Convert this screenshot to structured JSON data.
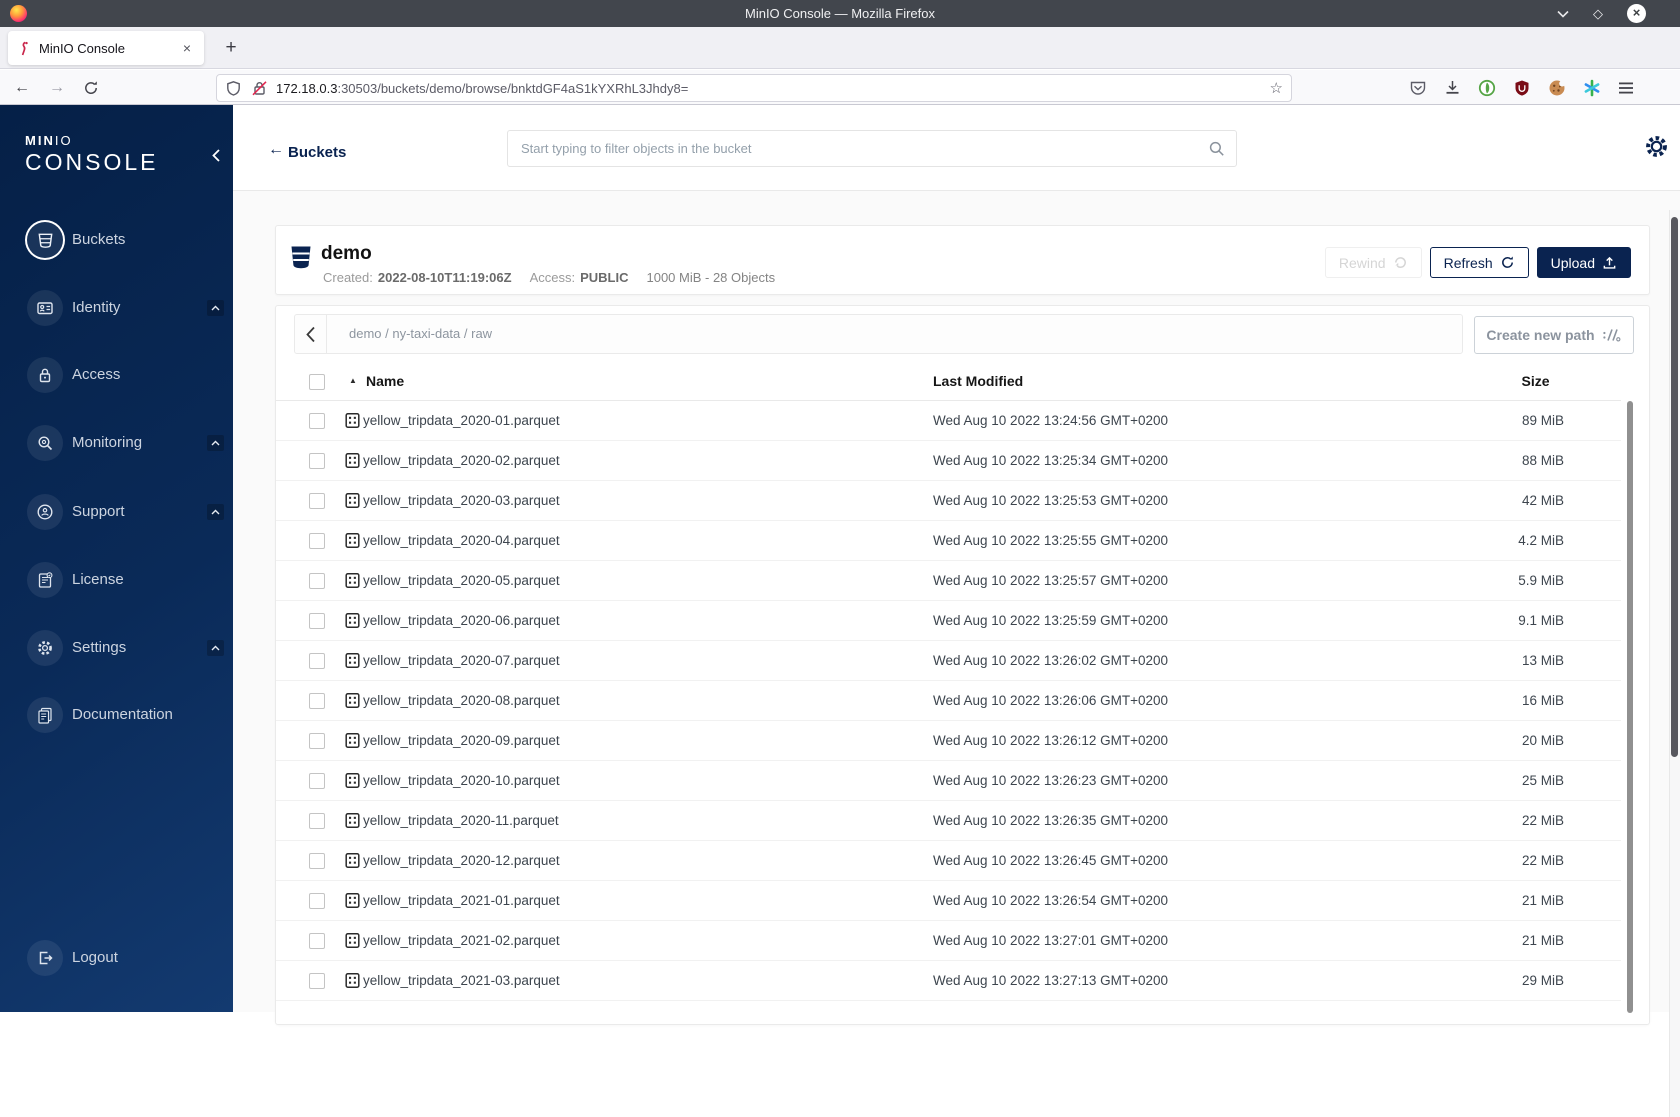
{
  "browser": {
    "window_title": "MinIO Console — Mozilla Firefox",
    "tab_title": "MinIO Console",
    "tab_close": "×",
    "new_tab": "+",
    "back": "←",
    "forward": "→",
    "url_domain": "172.18.0.3",
    "url_rest": ":30503/buckets/demo/browse/bnktdGF4aS1kYXRhL3Jhdy8=",
    "star": "☆"
  },
  "sidebar": {
    "logo_top_bold": "MIN",
    "logo_top_light": "IO",
    "logo_bottom": "CONSOLE",
    "items": [
      {
        "label": "Buckets"
      },
      {
        "label": "Identity"
      },
      {
        "label": "Access"
      },
      {
        "label": "Monitoring"
      },
      {
        "label": "Support"
      },
      {
        "label": "License"
      },
      {
        "label": "Settings"
      },
      {
        "label": "Documentation"
      }
    ],
    "logout_label": "Logout"
  },
  "header": {
    "back_label": "Buckets",
    "search_placeholder": "Start typing to filter objects in the bucket"
  },
  "bucket": {
    "name": "demo",
    "created_label": "Created:",
    "created_value": "2022-08-10T11:19:06Z",
    "access_label": "Access:",
    "access_value": "PUBLIC",
    "summary": "1000 MiB - 28 Objects",
    "rewind_label": "Rewind",
    "refresh_label": "Refresh",
    "upload_label": "Upload"
  },
  "browse": {
    "breadcrumb": "demo / ny-taxi-data / raw",
    "create_path_label": "Create new path",
    "columns": {
      "name": "Name",
      "modified": "Last Modified",
      "size": "Size"
    },
    "sort_arrow": "▲",
    "rows": [
      {
        "name": "yellow_tripdata_2020-01.parquet",
        "modified": "Wed Aug 10 2022 13:24:56 GMT+0200",
        "size": "89 MiB"
      },
      {
        "name": "yellow_tripdata_2020-02.parquet",
        "modified": "Wed Aug 10 2022 13:25:34 GMT+0200",
        "size": "88 MiB"
      },
      {
        "name": "yellow_tripdata_2020-03.parquet",
        "modified": "Wed Aug 10 2022 13:25:53 GMT+0200",
        "size": "42 MiB"
      },
      {
        "name": "yellow_tripdata_2020-04.parquet",
        "modified": "Wed Aug 10 2022 13:25:55 GMT+0200",
        "size": "4.2 MiB"
      },
      {
        "name": "yellow_tripdata_2020-05.parquet",
        "modified": "Wed Aug 10 2022 13:25:57 GMT+0200",
        "size": "5.9 MiB"
      },
      {
        "name": "yellow_tripdata_2020-06.parquet",
        "modified": "Wed Aug 10 2022 13:25:59 GMT+0200",
        "size": "9.1 MiB"
      },
      {
        "name": "yellow_tripdata_2020-07.parquet",
        "modified": "Wed Aug 10 2022 13:26:02 GMT+0200",
        "size": "13 MiB"
      },
      {
        "name": "yellow_tripdata_2020-08.parquet",
        "modified": "Wed Aug 10 2022 13:26:06 GMT+0200",
        "size": "16 MiB"
      },
      {
        "name": "yellow_tripdata_2020-09.parquet",
        "modified": "Wed Aug 10 2022 13:26:12 GMT+0200",
        "size": "20 MiB"
      },
      {
        "name": "yellow_tripdata_2020-10.parquet",
        "modified": "Wed Aug 10 2022 13:26:23 GMT+0200",
        "size": "25 MiB"
      },
      {
        "name": "yellow_tripdata_2020-11.parquet",
        "modified": "Wed Aug 10 2022 13:26:35 GMT+0200",
        "size": "22 MiB"
      },
      {
        "name": "yellow_tripdata_2020-12.parquet",
        "modified": "Wed Aug 10 2022 13:26:45 GMT+0200",
        "size": "22 MiB"
      },
      {
        "name": "yellow_tripdata_2021-01.parquet",
        "modified": "Wed Aug 10 2022 13:26:54 GMT+0200",
        "size": "21 MiB"
      },
      {
        "name": "yellow_tripdata_2021-02.parquet",
        "modified": "Wed Aug 10 2022 13:27:01 GMT+0200",
        "size": "21 MiB"
      },
      {
        "name": "yellow_tripdata_2021-03.parquet",
        "modified": "Wed Aug 10 2022 13:27:13 GMT+0200",
        "size": "29 MiB"
      }
    ]
  },
  "colors": {
    "accent_navy": "#0a2350",
    "sidebar_gradient_from": "#052047",
    "sidebar_gradient_to": "#133a70",
    "titlebar": "#42464d",
    "minio_red": "#c9264b",
    "content_bg": "#fafafa"
  }
}
